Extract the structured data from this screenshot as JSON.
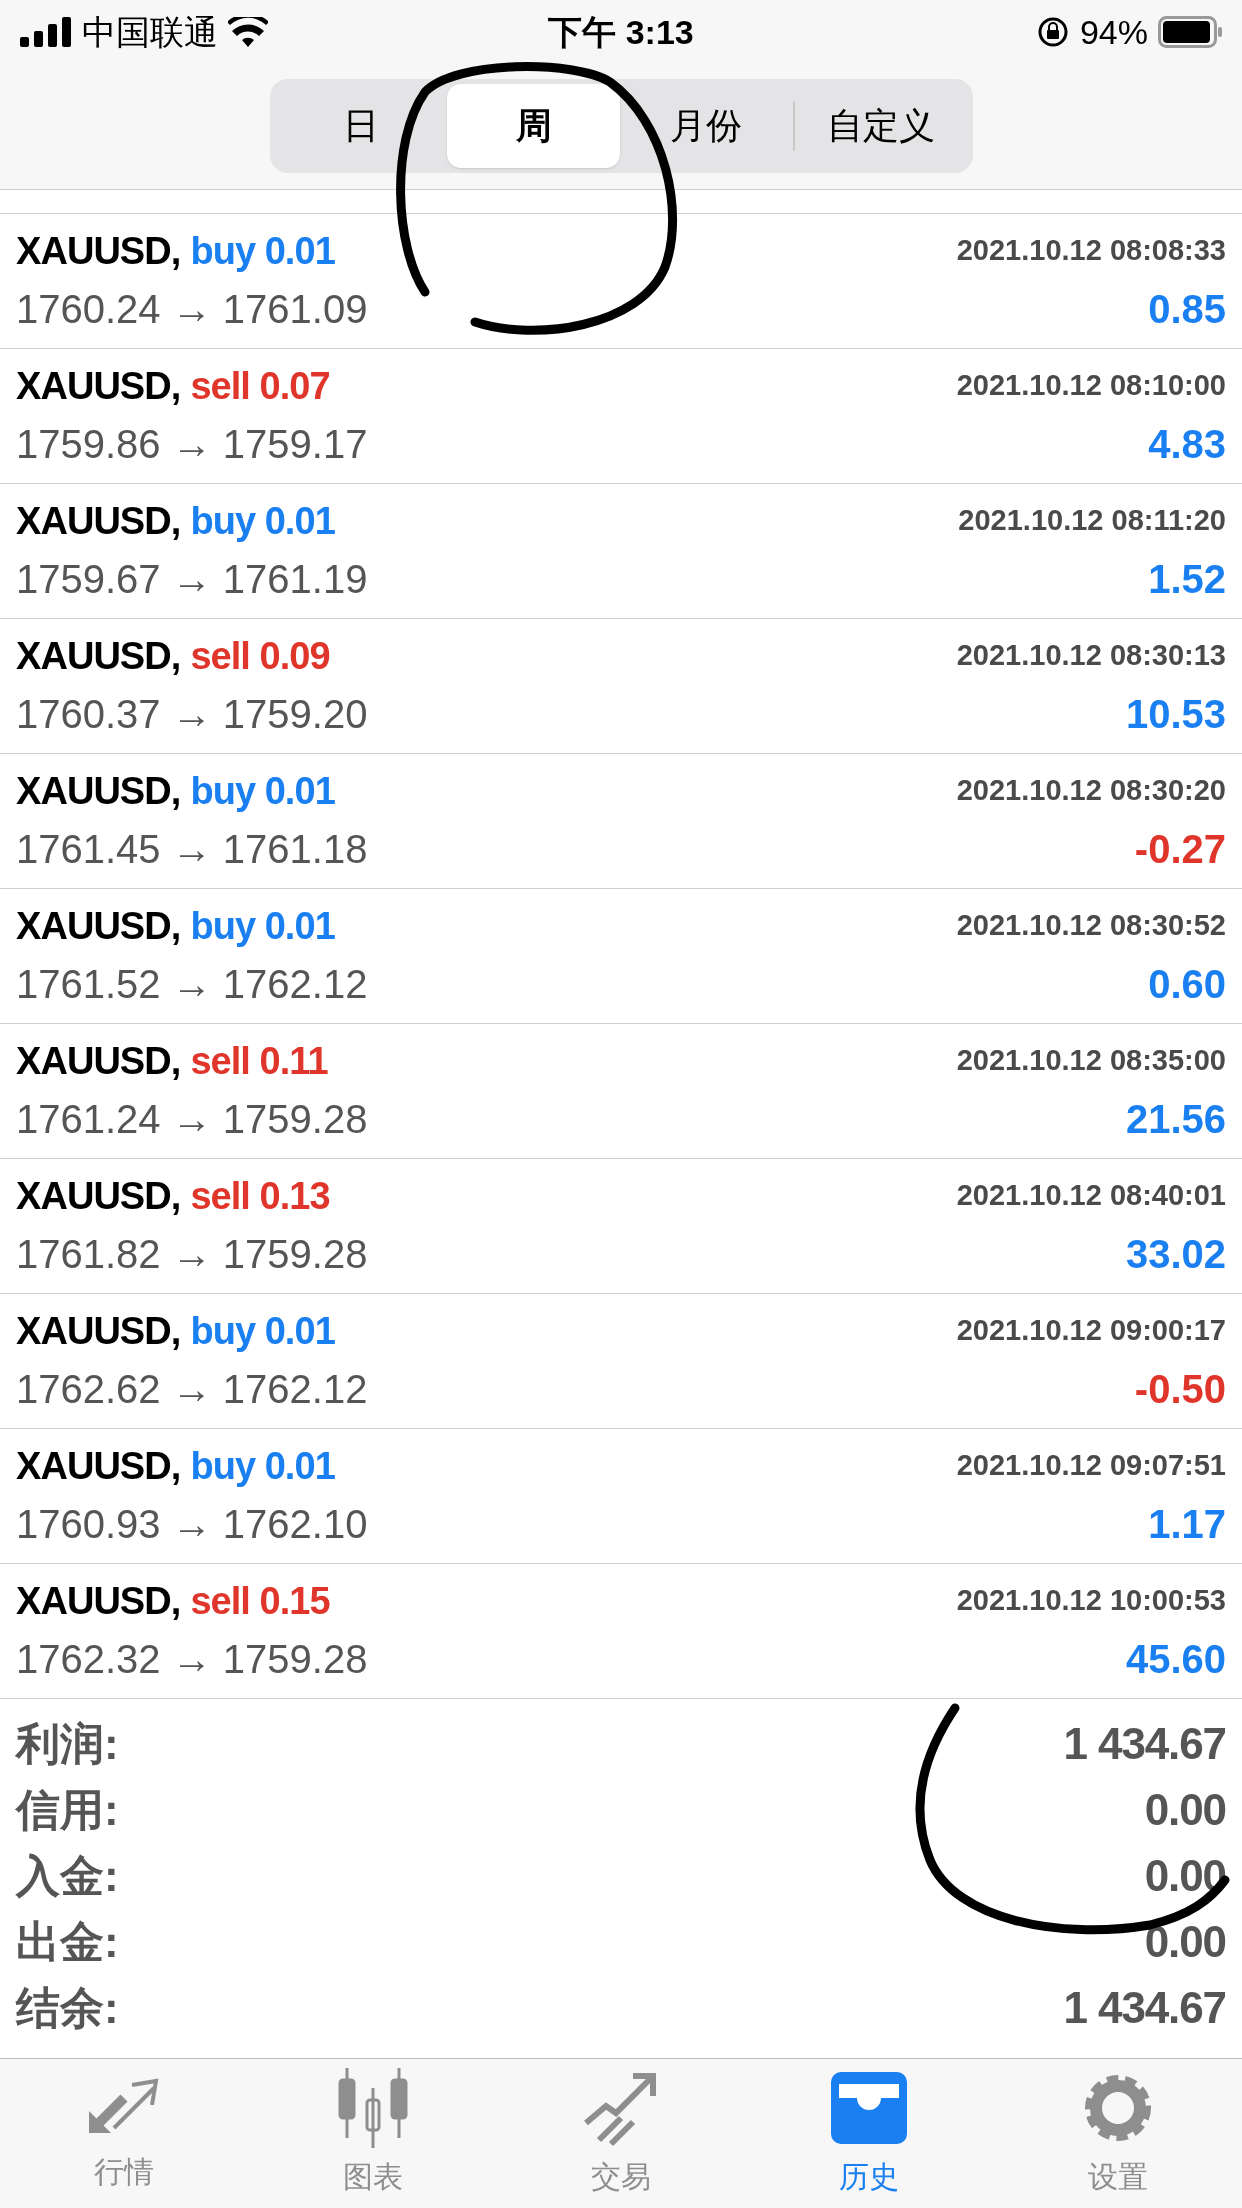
{
  "status_bar": {
    "carrier": "中国联通",
    "time": "下午 3:13",
    "battery": "94%"
  },
  "periods": [
    {
      "label": "日",
      "selected": false
    },
    {
      "label": "周",
      "selected": true
    },
    {
      "label": "月份",
      "selected": false
    },
    {
      "label": "自定义",
      "selected": false
    }
  ],
  "deals": [
    {
      "symbol": "XAUUSD,",
      "order": "buy 0.01",
      "kind": "buy",
      "time": "2021.10.12 08:08:33",
      "prices": "1760.24 → 1761.09",
      "profit": "0.85",
      "color": "#1a7ff0"
    },
    {
      "symbol": "XAUUSD,",
      "order": "sell 0.07",
      "kind": "sell",
      "time": "2021.10.12 08:10:00",
      "prices": "1759.86 → 1759.17",
      "profit": "4.83",
      "color": "#1a7ff0"
    },
    {
      "symbol": "XAUUSD,",
      "order": "buy 0.01",
      "kind": "buy",
      "time": "2021.10.12 08:11:20",
      "prices": "1759.67 → 1761.19",
      "profit": "1.52",
      "color": "#1a7ff0"
    },
    {
      "symbol": "XAUUSD,",
      "order": "sell 0.09",
      "kind": "sell",
      "time": "2021.10.12 08:30:13",
      "prices": "1760.37 → 1759.20",
      "profit": "10.53",
      "color": "#1a7ff0"
    },
    {
      "symbol": "XAUUSD,",
      "order": "buy 0.01",
      "kind": "buy",
      "time": "2021.10.12 08:30:20",
      "prices": "1761.45 → 1761.18",
      "profit": "-0.27",
      "color": "#e0352b"
    },
    {
      "symbol": "XAUUSD,",
      "order": "buy 0.01",
      "kind": "buy",
      "time": "2021.10.12 08:30:52",
      "prices": "1761.52 → 1762.12",
      "profit": "0.60",
      "color": "#1a7ff0"
    },
    {
      "symbol": "XAUUSD,",
      "order": "sell 0.11",
      "kind": "sell",
      "time": "2021.10.12 08:35:00",
      "prices": "1761.24 → 1759.28",
      "profit": "21.56",
      "color": "#1a7ff0"
    },
    {
      "symbol": "XAUUSD,",
      "order": "sell 0.13",
      "kind": "sell",
      "time": "2021.10.12 08:40:01",
      "prices": "1761.82 → 1759.28",
      "profit": "33.02",
      "color": "#1a7ff0"
    },
    {
      "symbol": "XAUUSD,",
      "order": "buy 0.01",
      "kind": "buy",
      "time": "2021.10.12 09:00:17",
      "prices": "1762.62 → 1762.12",
      "profit": "-0.50",
      "color": "#e0352b"
    },
    {
      "symbol": "XAUUSD,",
      "order": "buy 0.01",
      "kind": "buy",
      "time": "2021.10.12 09:07:51",
      "prices": "1760.93 → 1762.10",
      "profit": "1.17",
      "color": "#1a7ff0"
    },
    {
      "symbol": "XAUUSD,",
      "order": "sell 0.15",
      "kind": "sell",
      "time": "2021.10.12 10:00:53",
      "prices": "1762.32 → 1759.28",
      "profit": "45.60",
      "color": "#1a7ff0"
    }
  ],
  "summary": [
    {
      "label": "利润:",
      "value": "1 434.67"
    },
    {
      "label": "信用:",
      "value": "0.00"
    },
    {
      "label": "入金:",
      "value": "0.00"
    },
    {
      "label": "出金:",
      "value": "0.00"
    },
    {
      "label": "结余:",
      "value": "1 434.67"
    }
  ],
  "tab_bar": [
    {
      "label": "行情",
      "selected": false
    },
    {
      "label": "图表",
      "selected": false
    },
    {
      "label": "交易",
      "selected": false
    },
    {
      "label": "历史",
      "selected": true
    },
    {
      "label": "设置",
      "selected": false
    }
  ]
}
